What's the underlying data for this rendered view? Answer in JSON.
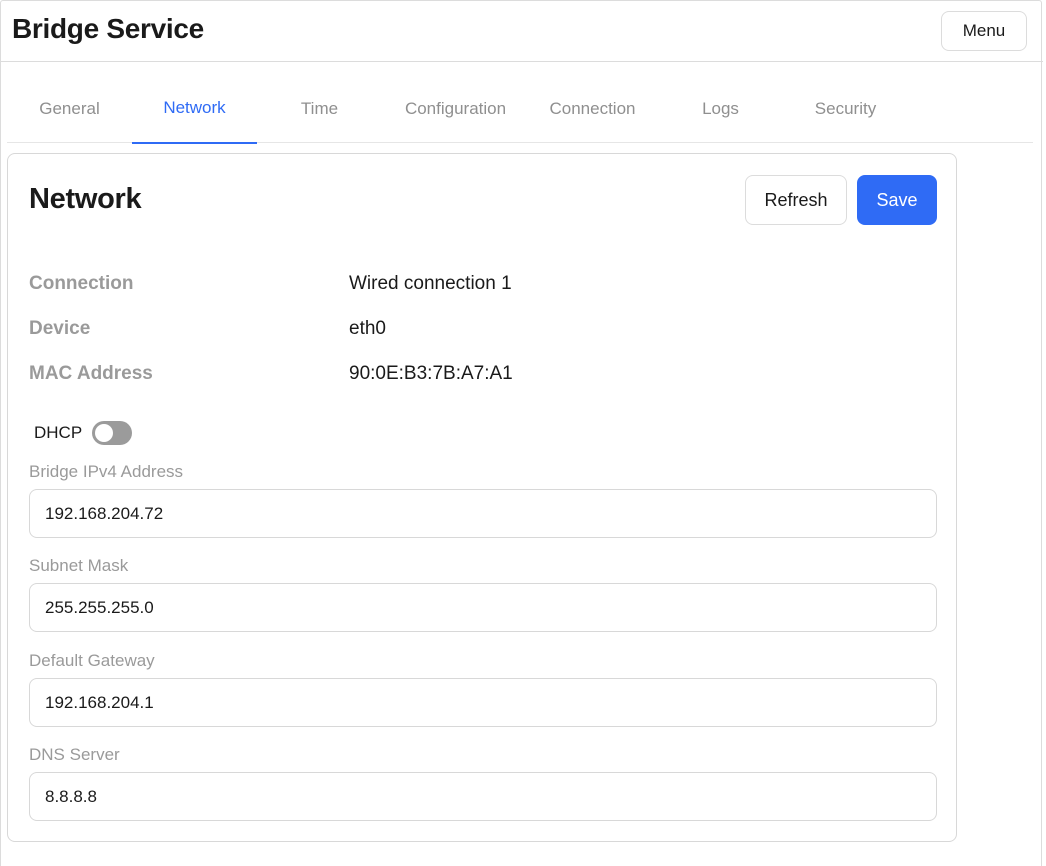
{
  "header": {
    "title": "Bridge Service",
    "menu_label": "Menu"
  },
  "tabs": [
    {
      "label": "General",
      "active": false
    },
    {
      "label": "Network",
      "active": true
    },
    {
      "label": "Time",
      "active": false
    },
    {
      "label": "Configuration",
      "active": false
    },
    {
      "label": "Connection",
      "active": false
    },
    {
      "label": "Logs",
      "active": false
    },
    {
      "label": "Security",
      "active": false
    }
  ],
  "network": {
    "title": "Network",
    "refresh_label": "Refresh",
    "save_label": "Save",
    "info": [
      {
        "label": "Connection",
        "value": "Wired connection 1"
      },
      {
        "label": "Device",
        "value": "eth0"
      },
      {
        "label": "MAC Address",
        "value": "90:0E:B3:7B:A7:A1"
      }
    ],
    "dhcp": {
      "label": "DHCP",
      "enabled": false
    },
    "fields": [
      {
        "label": "Bridge IPv4 Address",
        "value": "192.168.204.72"
      },
      {
        "label": "Subnet Mask",
        "value": "255.255.255.0"
      },
      {
        "label": "Default Gateway",
        "value": "192.168.204.1"
      },
      {
        "label": "DNS Server",
        "value": "8.8.8.8"
      }
    ]
  },
  "colors": {
    "accent": "#2f6bf5",
    "muted_text": "#9a9a9a",
    "toggle_off": "#9b9b9b"
  }
}
